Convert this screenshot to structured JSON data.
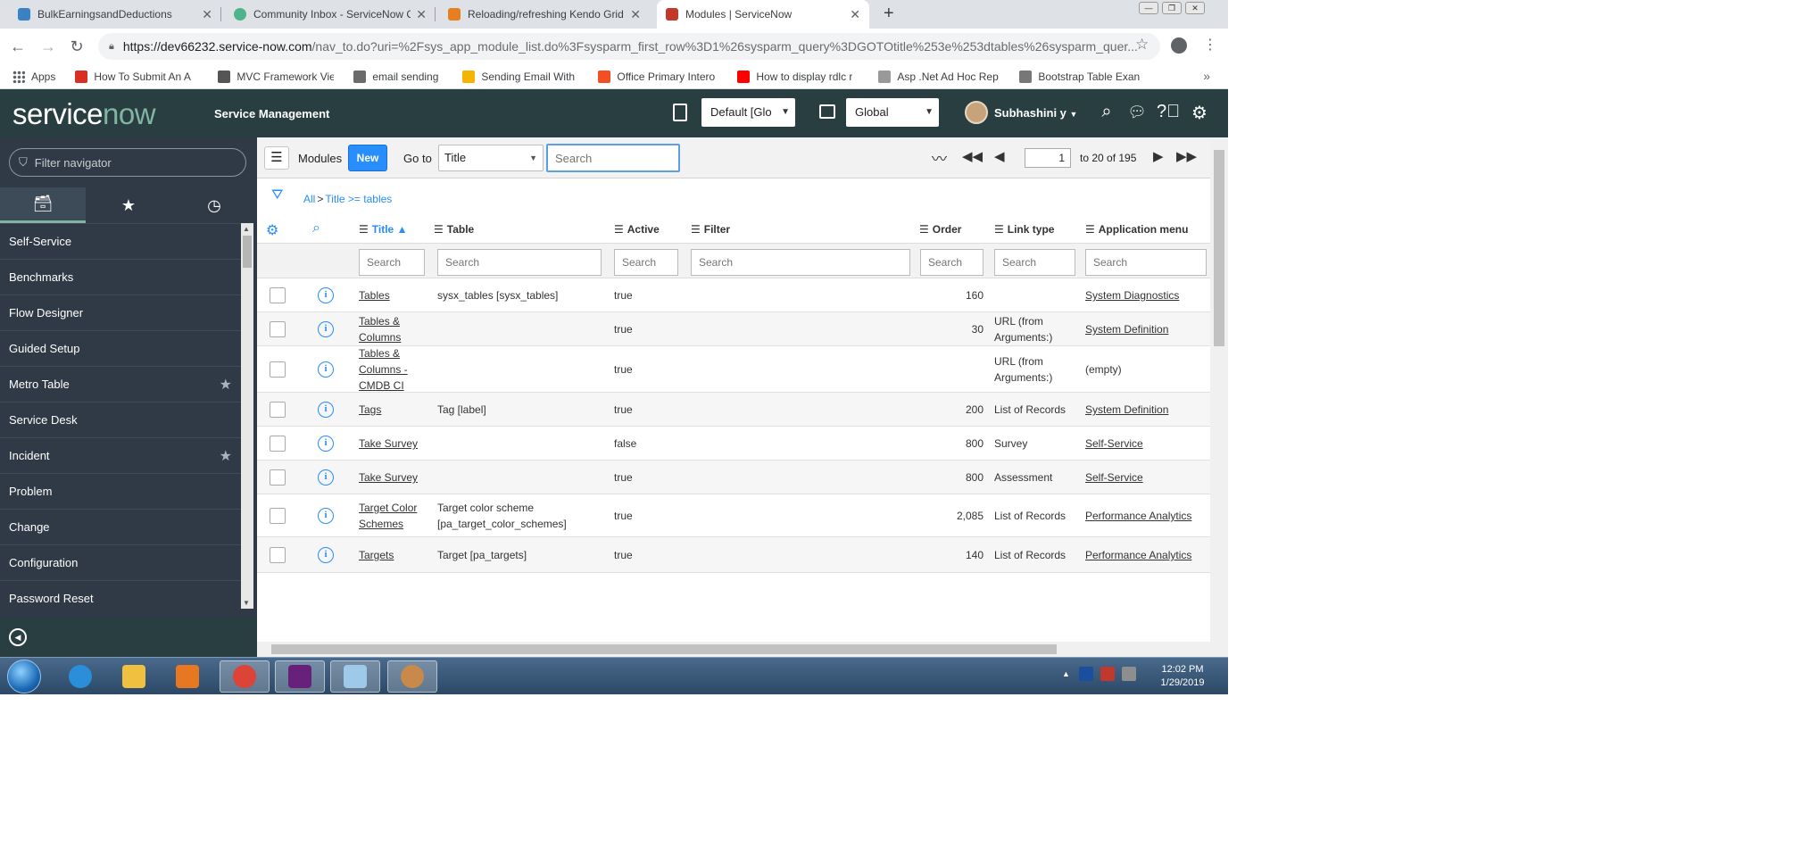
{
  "browser": {
    "tabs": [
      {
        "title": "BulkEarningsandDeductions",
        "color": "#3b82c4"
      },
      {
        "title": "Community Inbox - ServiceNow C",
        "color": "#4fb38c"
      },
      {
        "title": "Reloading/refreshing Kendo Grid",
        "color": "#e67e22"
      },
      {
        "title": "Modules | ServiceNow",
        "color": "#c0392b"
      }
    ],
    "new_tab_glyph": "+",
    "url_host": "https://dev66232.service-now.com",
    "url_rest": "/nav_to.do?uri=%2Fsys_app_module_list.do%3Fsysparm_first_row%3D1%26sysparm_query%3DGOTOtitle%253e%253dtables%26sysparm_quer...",
    "bookmarks": [
      {
        "label": "Apps",
        "color": "#5f6368"
      },
      {
        "label": "How To Submit An A",
        "color": "#d93025"
      },
      {
        "label": "MVC Framework Vie",
        "color": "#555555"
      },
      {
        "label": "email sending",
        "color": "#6b6b6b"
      },
      {
        "label": "Sending Email With H",
        "color": "#f4b400"
      },
      {
        "label": "Office Primary Intero",
        "color": "#f25022"
      },
      {
        "label": "How to display rdlc r",
        "color": "#ff0000"
      },
      {
        "label": "Asp .Net Ad Hoc Rep",
        "color": "#999999"
      },
      {
        "label": "Bootstrap Table Exan",
        "color": "#777777"
      }
    ],
    "bookmarks_more": "»"
  },
  "header": {
    "logo_service": "service",
    "logo_now": "now",
    "product": "Service Management",
    "domain_select": "Default [Glo",
    "scope_select": "Global",
    "user": "Subhashini y",
    "accent": "#81b5a1"
  },
  "navigator": {
    "filter_placeholder": "Filter navigator",
    "items": [
      {
        "label": "Self-Service",
        "starred": false
      },
      {
        "label": "Benchmarks",
        "starred": false
      },
      {
        "label": "Flow Designer",
        "starred": false
      },
      {
        "label": "Guided Setup",
        "starred": false
      },
      {
        "label": "Metro Table",
        "starred": true
      },
      {
        "label": "Service Desk",
        "starred": false
      },
      {
        "label": "Incident",
        "starred": true
      },
      {
        "label": "Problem",
        "starred": false
      },
      {
        "label": "Change",
        "starred": false
      },
      {
        "label": "Configuration",
        "starred": false
      },
      {
        "label": "Password Reset",
        "starred": false
      }
    ]
  },
  "list": {
    "title": "Modules",
    "new_label": "New",
    "goto_label": "Go to",
    "goto_field": "Title",
    "search_placeholder": "Search",
    "page_input": "1",
    "page_count": "to 20 of 195",
    "breadcrumb_all": "All",
    "breadcrumb_sep": ">",
    "breadcrumb_filter": "Title >= tables",
    "columns": [
      "Title",
      "Table",
      "Active",
      "Filter",
      "Order",
      "Link type",
      "Application menu"
    ],
    "sorted_indicator": "▲",
    "column_search_placeholder": "Search",
    "rows": [
      {
        "title": [
          "Tables"
        ],
        "table": [
          "sysx_tables [sysx_tables]"
        ],
        "active": "true",
        "order": "160",
        "link_type": [],
        "app_menu": "System Diagnostics"
      },
      {
        "title": [
          "Tables &",
          "Columns"
        ],
        "table": [],
        "active": "true",
        "order": "30",
        "link_type": [
          "URL (from",
          "Arguments:)"
        ],
        "app_menu": "System Definition"
      },
      {
        "title": [
          "Tables &",
          "Columns -",
          "CMDB CI"
        ],
        "table": [],
        "active": "true",
        "order": "",
        "link_type": [
          "URL (from",
          "Arguments:)"
        ],
        "app_menu": "(empty)"
      },
      {
        "title": [
          "Tags"
        ],
        "table": [
          "Tag [label]"
        ],
        "active": "true",
        "order": "200",
        "link_type": [
          "List of Records"
        ],
        "app_menu": "System Definition"
      },
      {
        "title": [
          "Take Survey"
        ],
        "table": [],
        "active": "false",
        "order": "800",
        "link_type": [
          "Survey"
        ],
        "app_menu": "Self-Service"
      },
      {
        "title": [
          "Take Survey"
        ],
        "table": [],
        "active": "true",
        "order": "800",
        "link_type": [
          "Assessment"
        ],
        "app_menu": "Self-Service"
      },
      {
        "title": [
          "Target Color",
          "Schemes"
        ],
        "table": [
          "Target color scheme",
          "[pa_target_color_schemes]"
        ],
        "active": "true",
        "order": "2,085",
        "link_type": [
          "List of Records"
        ],
        "app_menu": "Performance Analytics"
      },
      {
        "title": [
          "Targets"
        ],
        "table": [
          "Target [pa_targets]"
        ],
        "active": "true",
        "order": "140",
        "link_type": [
          "List of Records"
        ],
        "app_menu": "Performance Analytics"
      }
    ]
  },
  "taskbar": {
    "apps": [
      {
        "name": "internet-explorer",
        "color": "#2a8fd8"
      },
      {
        "name": "file-explorer",
        "color": "#f0c040"
      },
      {
        "name": "media-player",
        "color": "#e87722"
      },
      {
        "name": "chrome",
        "color": "#db4437"
      },
      {
        "name": "visual-studio",
        "color": "#68217a"
      },
      {
        "name": "notepad",
        "color": "#9ec9e8"
      },
      {
        "name": "paint",
        "color": "#c78a4a"
      }
    ],
    "time": "12:02 PM",
    "date": "1/29/2019"
  }
}
